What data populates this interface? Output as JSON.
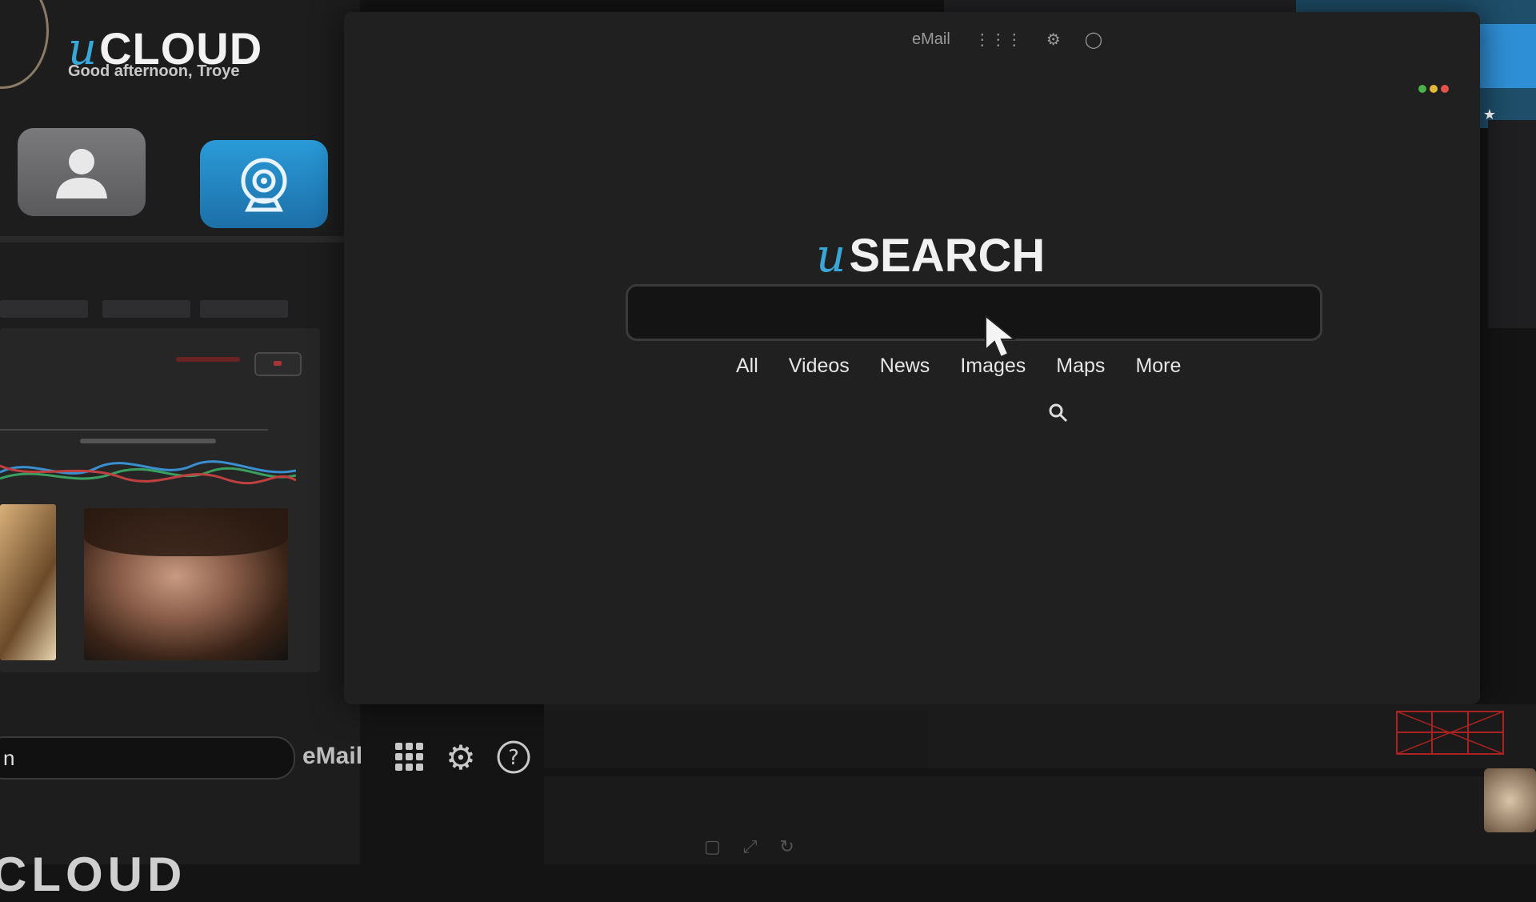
{
  "ucloud": {
    "logo_prefix": "u",
    "logo_text": "CLOUD",
    "greeting": "Good afternoon, Troye",
    "tiles": [
      "user-tile",
      "camera-tile"
    ],
    "bottom_search_value": "n",
    "email_label": "eMail",
    "bottom_wordmark": "CLOUD"
  },
  "usearch": {
    "logo_prefix": "u",
    "logo_text": "SEARCH",
    "search_value": "",
    "top_menu": {
      "email": "eMail"
    },
    "tabs": [
      "All",
      "Videos",
      "News",
      "Images",
      "Maps",
      "More"
    ]
  },
  "colors": {
    "accent": "#3aa6d8",
    "window_bg": "#202021",
    "search_bg": "#141414",
    "dot_red": "#e0524a",
    "dot_yellow": "#e0b93a",
    "dot_green": "#4ab34a"
  }
}
